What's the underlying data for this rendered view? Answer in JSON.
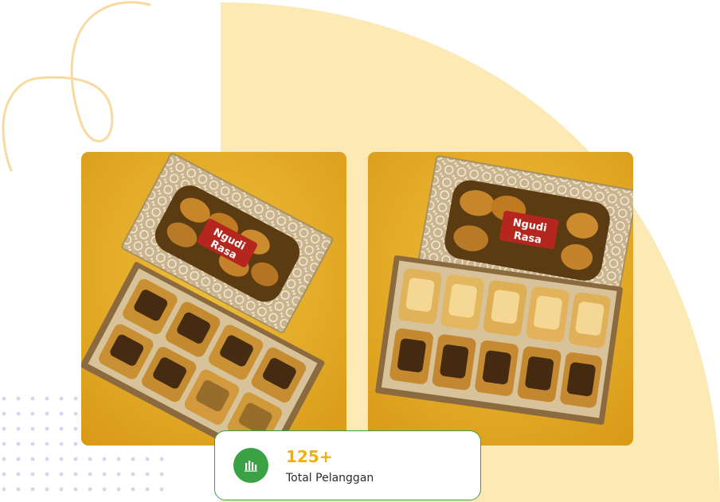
{
  "images": [
    {
      "alt": "Kotak kue Ngudi Rasa dengan pastry cokelat",
      "brand_text": "Ngudi Rasa"
    },
    {
      "alt": "Kotak kue Ngudi Rasa dengan pastry keju dan cokelat",
      "brand_text": "Ngudi Rasa"
    }
  ],
  "stat": {
    "value": "125+",
    "label": "Total Pelanggan",
    "icon": "bar-chart-icon"
  },
  "colors": {
    "accent_yellow": "#f2b10a",
    "accent_green": "#3aa144",
    "bg_shape": "#fde9b4",
    "squiggle": "#f8d9a0",
    "dots": "#d7d3f1"
  }
}
